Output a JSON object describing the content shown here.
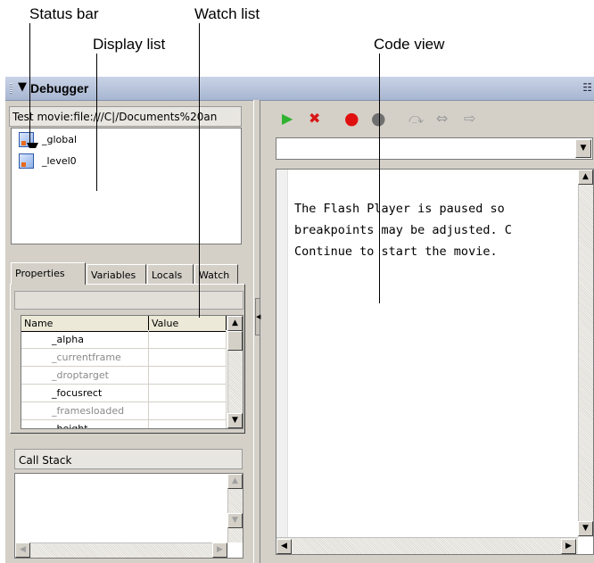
{
  "annotations": {
    "status_bar": "Status bar",
    "watch_list": "Watch list",
    "display_list": "Display list",
    "code_view": "Code view"
  },
  "panel": {
    "title": "Debugger",
    "collapse_glyph": "▼",
    "options_glyph": "☷"
  },
  "status_bar": {
    "text": "Test movie:file:///C|/Documents%20an"
  },
  "display_list": {
    "items": [
      {
        "label": "_global",
        "icon": "movie-clip-icon"
      },
      {
        "label": "_level0",
        "icon": "movie-clip-icon"
      }
    ]
  },
  "tabs": [
    {
      "label": "Properties",
      "active": true
    },
    {
      "label": "Variables",
      "active": false
    },
    {
      "label": "Locals",
      "active": false
    },
    {
      "label": "Watch",
      "active": false
    }
  ],
  "properties_grid": {
    "columns": [
      "Name",
      "Value"
    ],
    "rows": [
      {
        "name": "_alpha",
        "value": "",
        "dimmed": false
      },
      {
        "name": "_currentframe",
        "value": "",
        "dimmed": true
      },
      {
        "name": "_droptarget",
        "value": "",
        "dimmed": true
      },
      {
        "name": "_focusrect",
        "value": "",
        "dimmed": false
      },
      {
        "name": "_framesloaded",
        "value": "",
        "dimmed": true
      },
      {
        "name": "_height",
        "value": "",
        "dimmed": false
      }
    ]
  },
  "call_stack": {
    "label": "Call Stack"
  },
  "toolbar": {
    "continue": "▶",
    "stop_debugging": "✖",
    "toggle_breakpoint": "●",
    "remove_all_breakpoints": "●",
    "step_over": "⤼",
    "step_in": "⇔",
    "step_out": "⇨",
    "colors": {
      "continue": "#2fb22f",
      "stop": "#d81818",
      "breakpoint": "#e01010",
      "remove": "#707070",
      "step": "#9a9a9a"
    }
  },
  "code_view": {
    "lines": [
      "The Flash Player is paused so",
      "breakpoints may be adjusted. C",
      "Continue to start the movie."
    ]
  },
  "scroll_glyphs": {
    "up": "▲",
    "down": "▼",
    "left": "◀",
    "right": "▶",
    "expand": "◀"
  }
}
